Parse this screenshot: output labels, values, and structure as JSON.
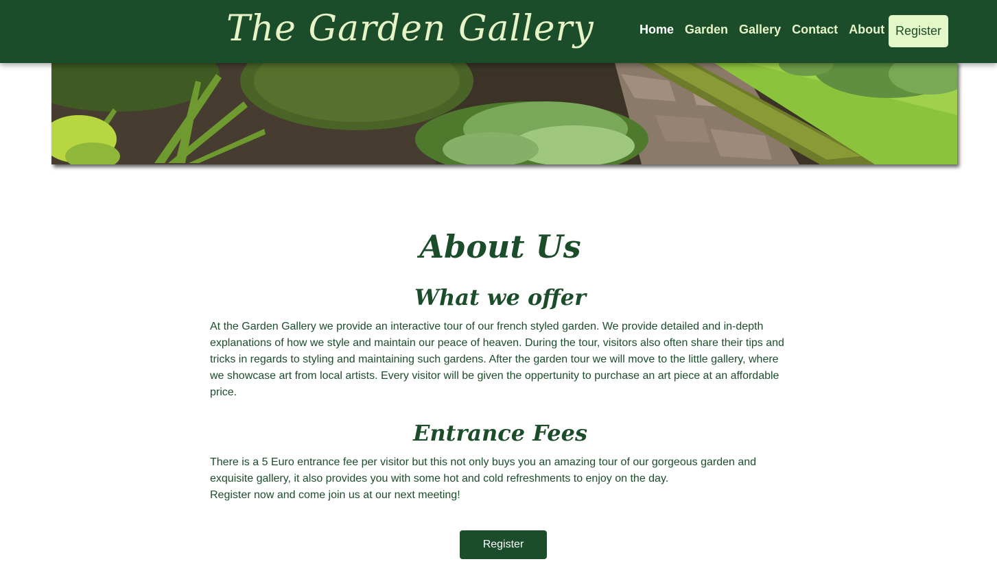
{
  "header": {
    "brand": "The Garden Gallery",
    "nav": [
      "Home",
      "Garden",
      "Gallery",
      "Contact",
      "About"
    ],
    "register_label": "Register"
  },
  "main": {
    "title": "About Us",
    "sections": [
      {
        "title": "What we offer",
        "paragraphs": [
          "At the Garden Gallery we provide an interactive tour of our french styled garden. We provide detailed and in-depth explanations of how we style and maintain our peace of heaven. During the tour, visitors also often share their tips and tricks in regards to styling and maintaining such gardens. After the garden tour we will move to the little gallery, where we showcase art from local artists. Every visitor will be given the oppertunity to purchase an art piece at an affordable price."
        ]
      },
      {
        "title": "Entrance Fees",
        "paragraphs": [
          "There is a 5 Euro entrance fee per visitor but this not only buys you an amazing tour of our gorgeous garden and exquisite gallery, it also provides you with some hot and cold refreshments to enjoy on the day.",
          "Register now and come join us at our next meeting!"
        ]
      }
    ],
    "cta_label": "Register"
  },
  "colors": {
    "header_bg": "#1b4d2b",
    "accent_light": "#e3f7c9",
    "text": "#1b4d2b"
  }
}
